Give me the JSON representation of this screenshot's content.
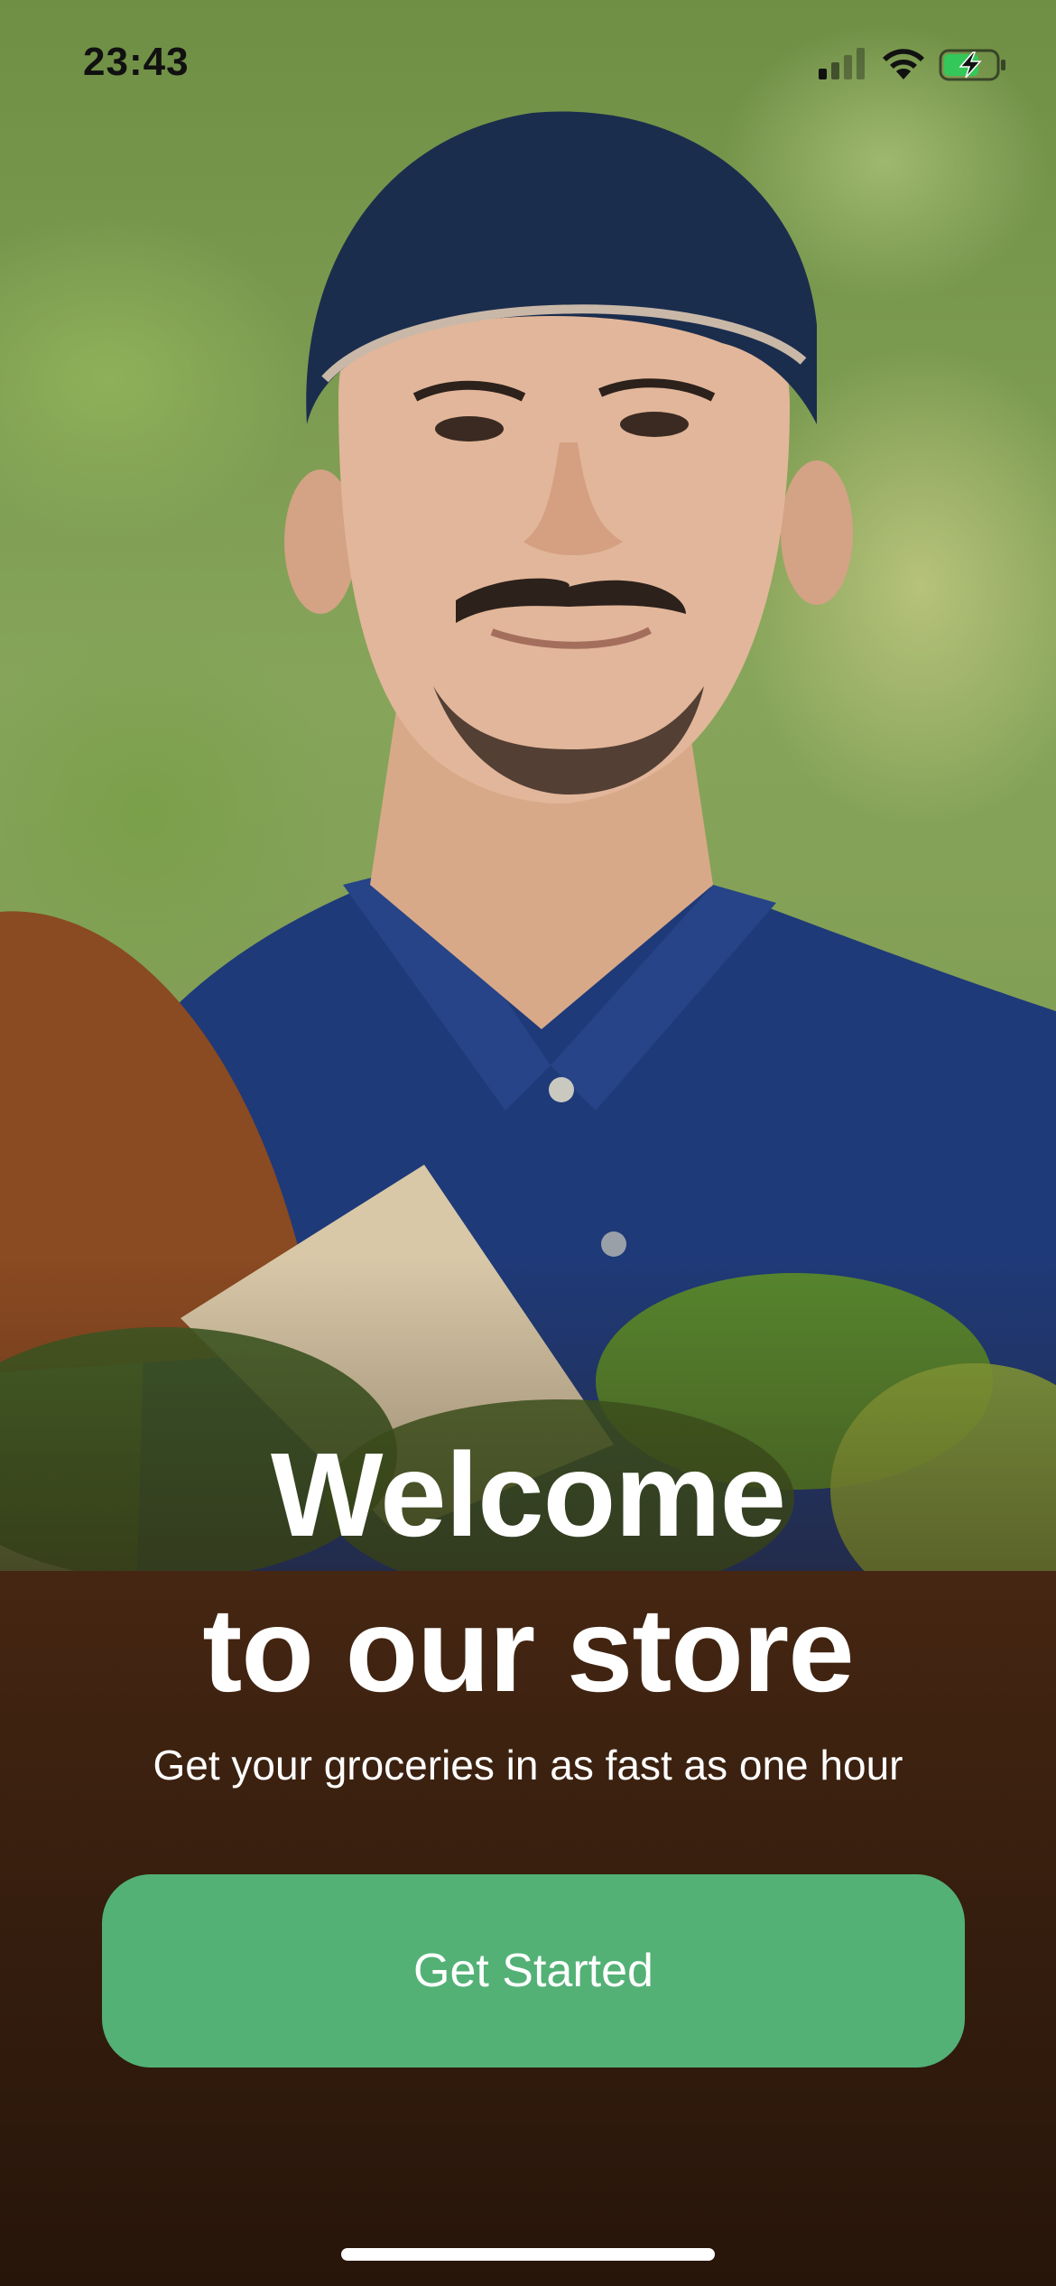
{
  "status_bar": {
    "time": "23:43"
  },
  "welcome": {
    "title_line1": "Welcome",
    "title_line2": "to our store",
    "subtitle": "Get your groceries in as fast as one hour"
  },
  "actions": {
    "get_started_label": "Get Started"
  },
  "colors": {
    "accent": "#53b175",
    "text_on_image": "#ffffff"
  },
  "icons": [
    "signal-icon",
    "wifi-icon",
    "battery-charging-icon"
  ]
}
